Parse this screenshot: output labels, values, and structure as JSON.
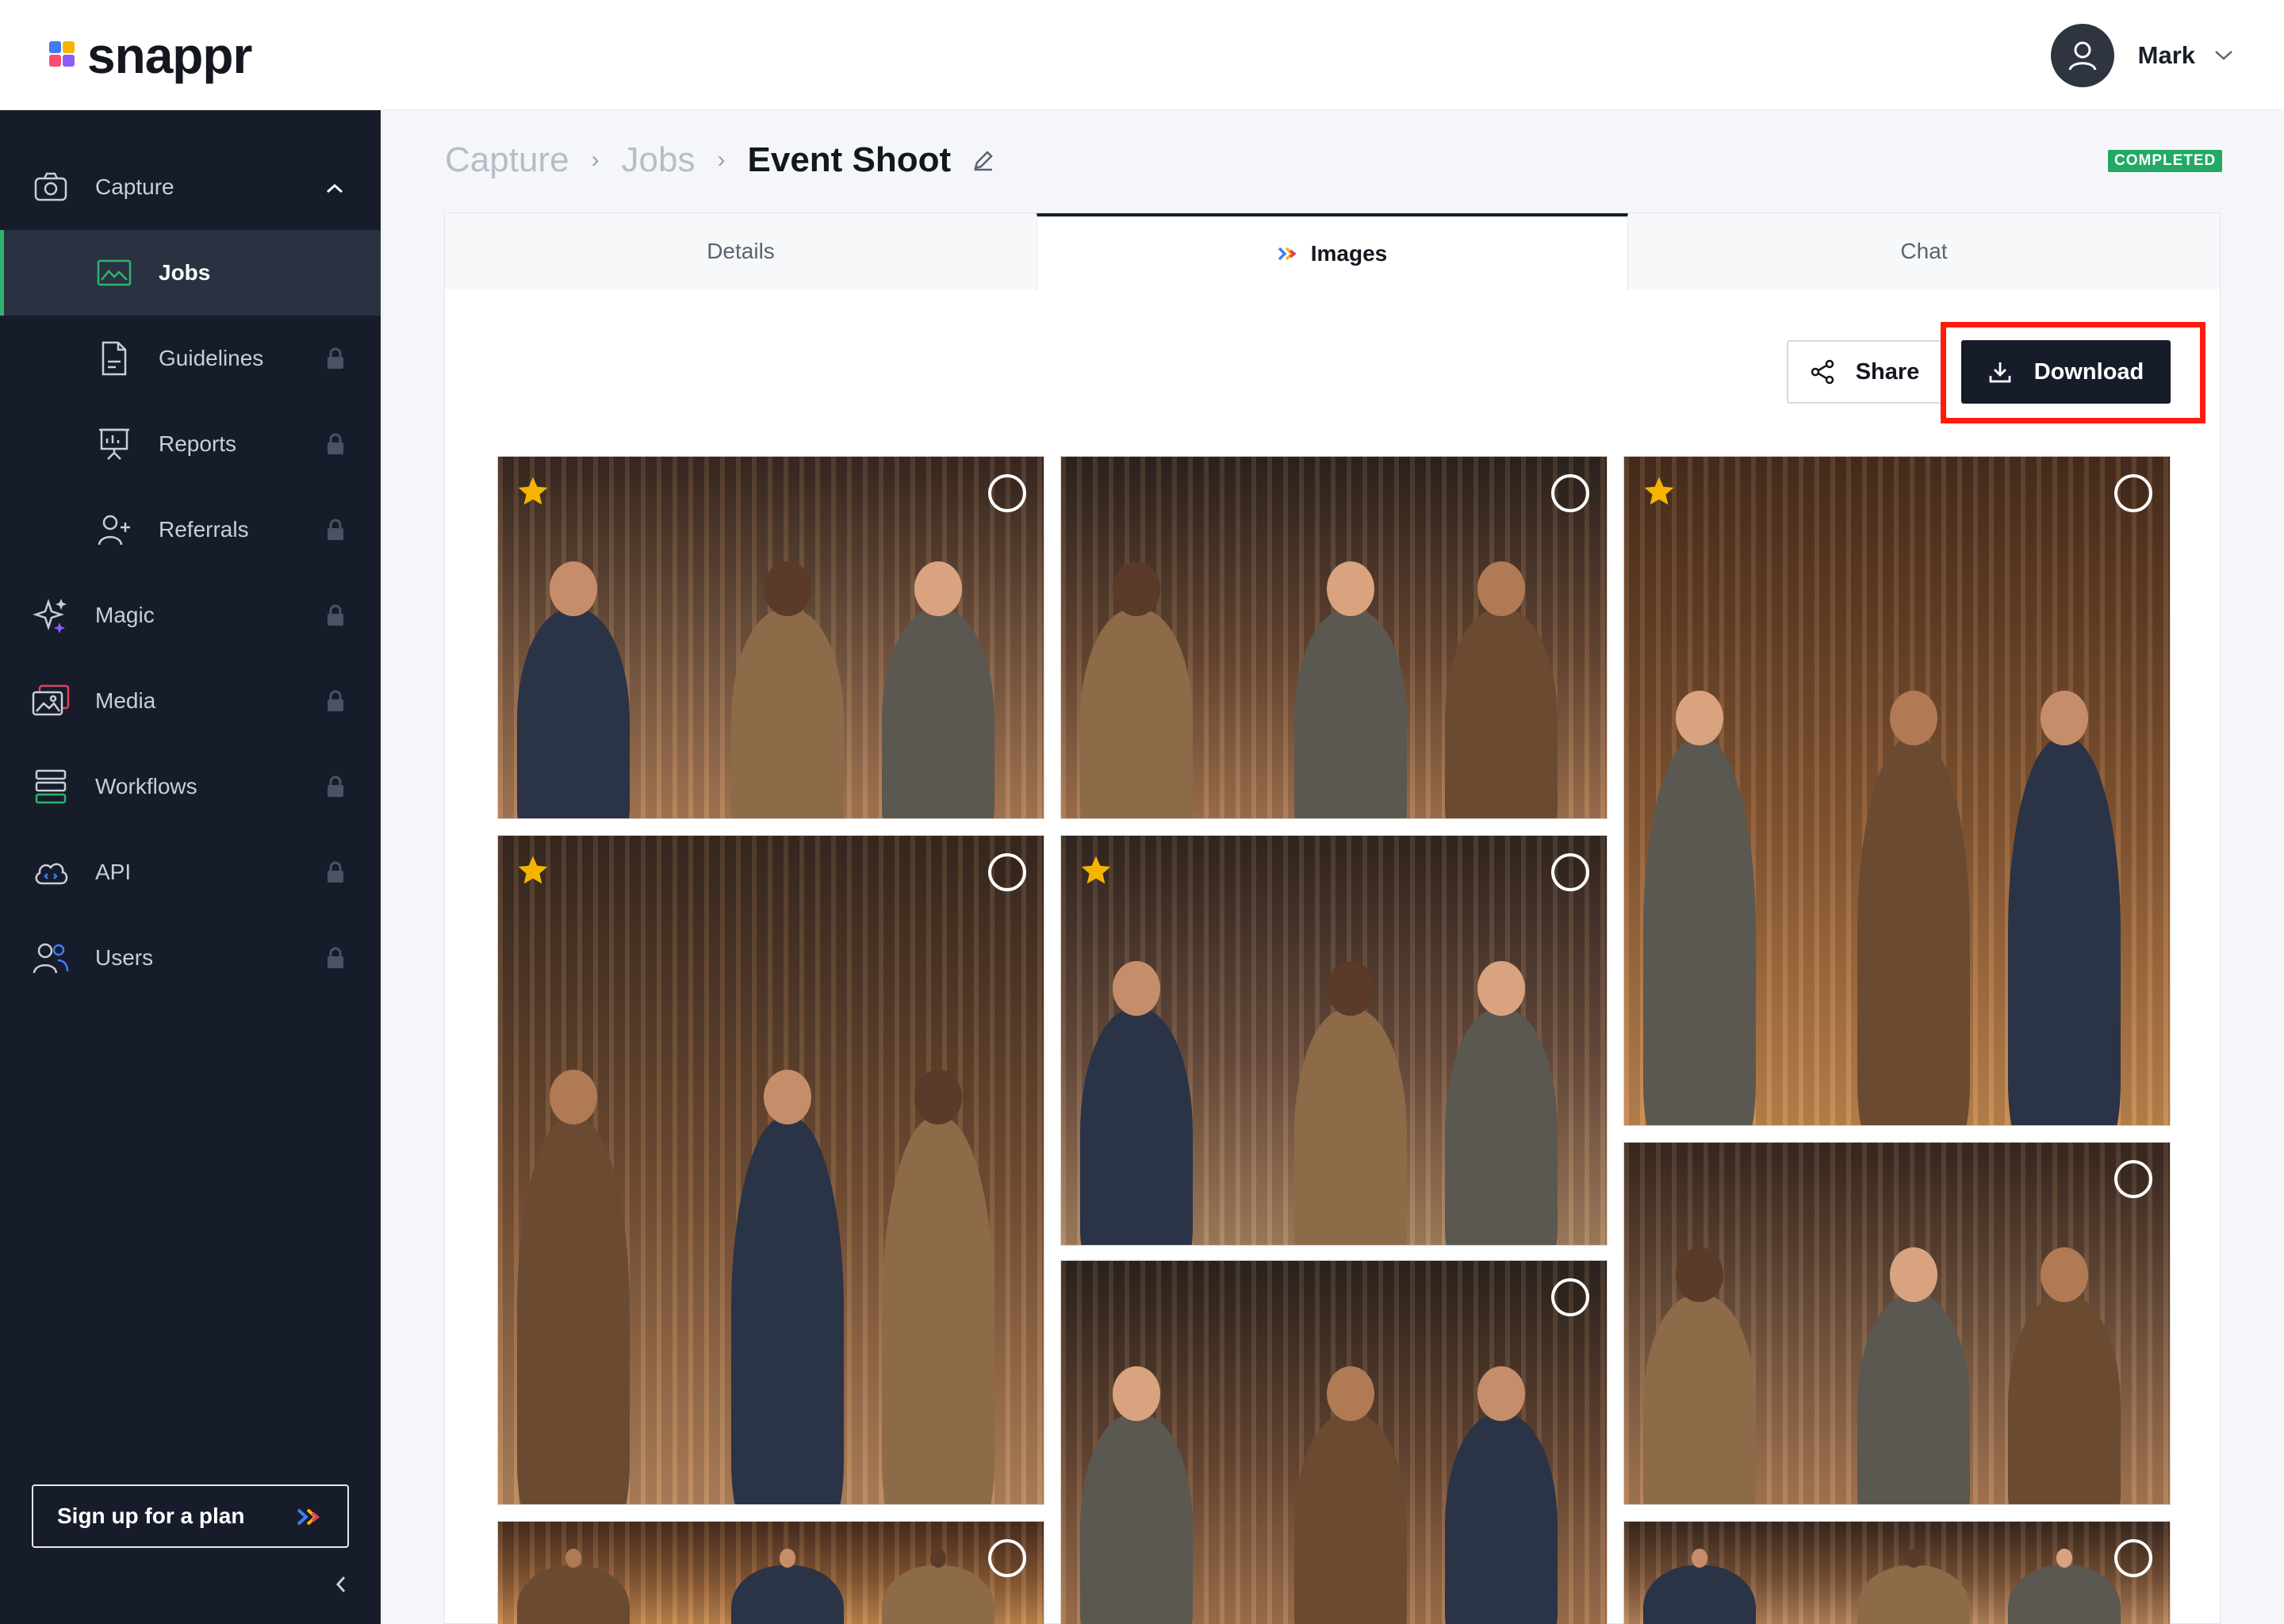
{
  "app": {
    "name": "snappr"
  },
  "user": {
    "name": "Mark"
  },
  "sidebar": {
    "items": [
      {
        "label": "Capture",
        "icon": "camera-icon",
        "locked": false,
        "expanded": true
      },
      {
        "label": "Jobs",
        "icon": "image-icon",
        "locked": false,
        "active": true
      },
      {
        "label": "Guidelines",
        "icon": "document-icon",
        "locked": true
      },
      {
        "label": "Reports",
        "icon": "presentation-icon",
        "locked": true
      },
      {
        "label": "Referrals",
        "icon": "add-user-icon",
        "locked": true
      },
      {
        "label": "Magic",
        "icon": "sparkle-icon",
        "locked": true
      },
      {
        "label": "Media",
        "icon": "gallery-icon",
        "locked": true
      },
      {
        "label": "Workflows",
        "icon": "stack-icon",
        "locked": true
      },
      {
        "label": "API",
        "icon": "cloud-code-icon",
        "locked": true
      },
      {
        "label": "Users",
        "icon": "users-icon",
        "locked": true
      }
    ],
    "signup_label": "Sign up for a plan"
  },
  "breadcrumb": {
    "items": [
      "Capture",
      "Jobs"
    ],
    "current": "Event Shoot"
  },
  "status": "COMPLETED",
  "tabs": [
    {
      "label": "Details",
      "active": false
    },
    {
      "label": "Images",
      "active": true
    },
    {
      "label": "Chat",
      "active": false
    }
  ],
  "actions": {
    "share_label": "Share",
    "download_label": "Download"
  },
  "gallery": {
    "images": [
      {
        "starred": true
      },
      {
        "starred": false
      },
      {
        "starred": true
      },
      {
        "starred": true
      },
      {
        "starred": true
      },
      {
        "starred": false
      },
      {
        "starred": false
      },
      {
        "starred": false
      },
      {
        "starred": false
      },
      {
        "starred": true
      }
    ]
  },
  "colors": {
    "sidebar_bg": "#161c2a",
    "accent_green": "#2fb36e",
    "badge_green": "#23a866",
    "highlight_red": "#ff1a0a",
    "star_yellow": "#f5b400"
  }
}
